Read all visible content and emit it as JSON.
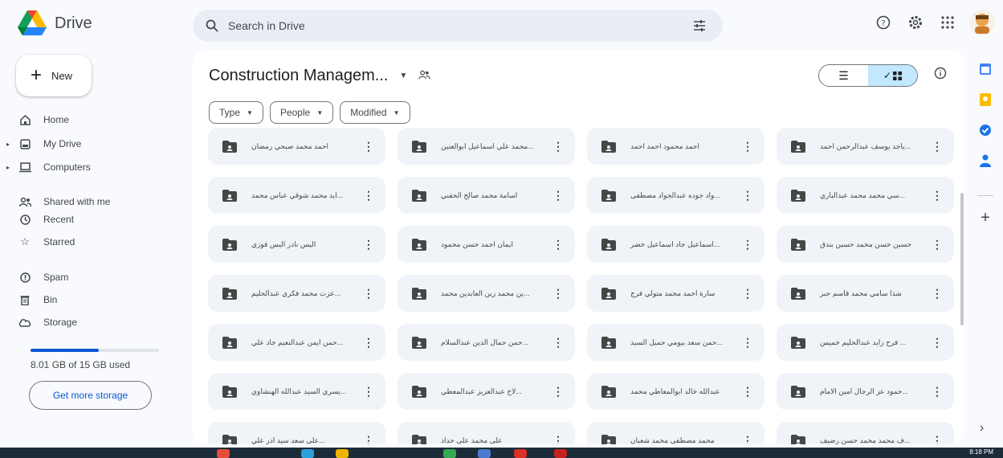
{
  "app": {
    "name": "Drive"
  },
  "search": {
    "placeholder": "Search in Drive",
    "icon": "search-icon",
    "filter_icon": "tune-icon"
  },
  "header_icons": [
    "help-icon",
    "settings-icon",
    "apps-icon",
    "account-avatar"
  ],
  "new_button": {
    "label": "New"
  },
  "sidebar": {
    "items": [
      {
        "label": "Home",
        "icon": "home-icon"
      },
      {
        "label": "My Drive",
        "icon": "my-drive-icon",
        "expandable": true
      },
      {
        "label": "Computers",
        "icon": "computer-icon",
        "expandable": true
      },
      {
        "label": "Shared with me",
        "icon": "shared-icon"
      },
      {
        "label": "Recent",
        "icon": "clock-icon"
      },
      {
        "label": "Starred",
        "icon": "star-icon"
      },
      {
        "label": "Spam",
        "icon": "spam-icon"
      },
      {
        "label": "Bin",
        "icon": "trash-icon"
      },
      {
        "label": "Storage",
        "icon": "cloud-icon"
      }
    ]
  },
  "storage": {
    "used_text": "8.01 GB of 15 GB used",
    "used_fraction": 0.534,
    "button": "Get more storage"
  },
  "folder": {
    "title": "Construction Managem...",
    "shared": true
  },
  "view": {
    "mode": "grid"
  },
  "filters": [
    {
      "label": "Type"
    },
    {
      "label": "People"
    },
    {
      "label": "Modified"
    }
  ],
  "folders": [
    "احمد محمد صبحي رمضان",
    "...محمد علي اسماعيل ابوالعنين",
    "احمد محمود احمد احمد",
    "...ياجد يوسف عبدالرحمن احمد",
    "...ايد محمد شوقي عباس محمد",
    "اسامة محمد صالح الحفني",
    "...واد جوده عبدالجواد مصطفى",
    "...سي محمد محمد عبدالباري",
    "اليس نادر اليس فوزي",
    "ايمان احمد حسن محمود",
    "...اسماعيل جاد اسماعيل خضر",
    "حسين حسن محمد حسين بندق",
    "...عزت محمد فكري عبدالحليم",
    "...ين محمد زين العابدين محمد",
    "سارة احمد محمد متولي فرج",
    "شذا سامي محمد قاسم جبر",
    "...حمن ايمن عبدالنعيم جاد علي",
    "...حمن جمال الدين عبدالسلام",
    "...حمن سعد بيومي جميل السيد",
    "... فرح زايد عبدالحليم خميس",
    "...يسري السيد عبدالله الهنشاوي",
    "...لاح عبدالعزيز عبدالمعطي",
    "عبدالله خالد ابوالمعاطي محمد",
    "...حمود عز الرجال امين الامام",
    "...على سعد سيد ادر علي",
    "على محمد على حداد",
    "محمد مصطفى محمد شعبان",
    "...ف محمد محمد حسن رضيف"
  ],
  "right_rail": [
    "calendar-icon",
    "keep-icon",
    "tasks-icon",
    "contacts-icon",
    "add-icon"
  ],
  "taskbar": {
    "time": "8:18 PM"
  },
  "colors": {
    "accent": "#0b57d0",
    "selected": "#c2e7ff",
    "card": "#f0f4f9",
    "bg": "#f8fafd"
  }
}
